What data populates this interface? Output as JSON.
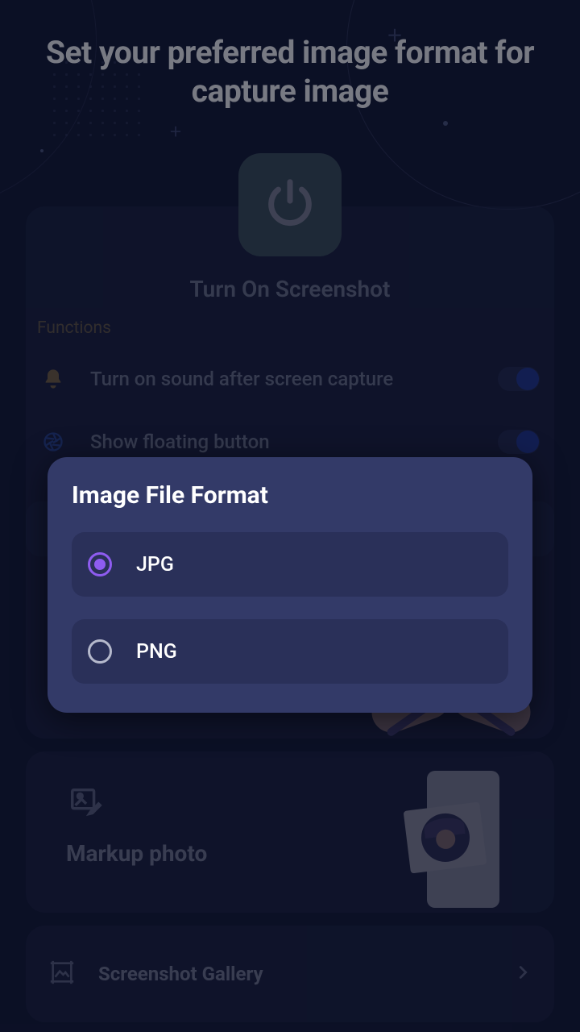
{
  "header": {
    "title": "Set your preferred image format for capture image"
  },
  "main": {
    "turn_on_label": "Turn On Screenshot",
    "functions_heading": "Functions",
    "func_sound": "Turn on sound after screen capture",
    "func_floating": "Show floating button",
    "markup_label": "Markup photo",
    "gallery_label": "Screenshot Gallery"
  },
  "dialog": {
    "title": "Image File Format",
    "options": {
      "jpg": "JPG",
      "png": "PNG"
    }
  }
}
